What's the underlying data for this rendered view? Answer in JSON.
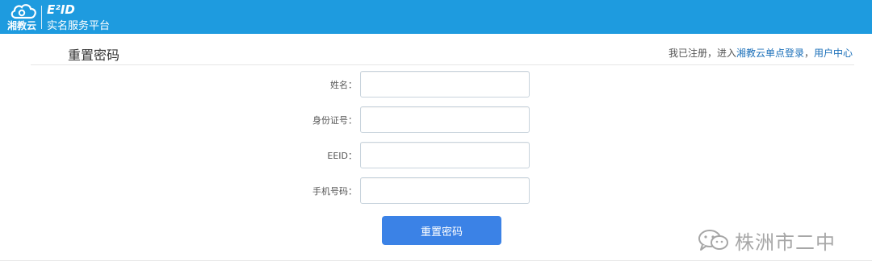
{
  "header": {
    "brand_name": "湘教云",
    "product_name": "E²ID",
    "platform_subtitle": "实名服务平台",
    "accent_color": "#1e9bdf"
  },
  "page": {
    "title": "重置密码",
    "links": {
      "prefix": "我已注册，进入",
      "sso_login": "湘教云单点登录",
      "separator": "，",
      "user_center": "用户中心"
    }
  },
  "form": {
    "fields": [
      {
        "label": "姓名：",
        "value": "",
        "placeholder": ""
      },
      {
        "label": "身份证号：",
        "value": "",
        "placeholder": ""
      },
      {
        "label": "EEID：",
        "value": "",
        "placeholder": ""
      },
      {
        "label": "手机号码：",
        "value": "",
        "placeholder": ""
      }
    ],
    "submit_label": "重置密码",
    "button_color": "#3b82e6"
  },
  "watermark": {
    "text": "株洲市二中",
    "icon": "wechat-icon"
  }
}
